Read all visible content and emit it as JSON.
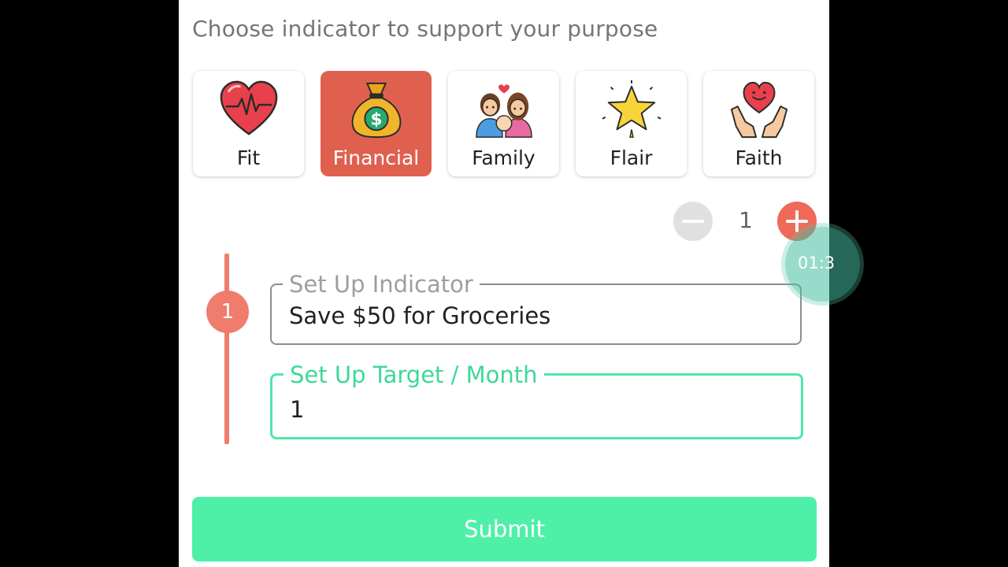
{
  "heading": "Choose indicator to support your purpose",
  "categories": [
    {
      "label": "Fit",
      "icon": "heart-pulse-icon",
      "selected": false
    },
    {
      "label": "Financial",
      "icon": "money-bag-icon",
      "selected": true
    },
    {
      "label": "Family",
      "icon": "family-icon",
      "selected": false
    },
    {
      "label": "Flair",
      "icon": "star-icon",
      "selected": false
    },
    {
      "label": "Faith",
      "icon": "heart-hands-icon",
      "selected": false
    }
  ],
  "stepper": {
    "count": "1",
    "minus_icon": "minus-icon",
    "plus_icon": "plus-icon"
  },
  "timer": {
    "text": "01:3"
  },
  "step": {
    "number": "1"
  },
  "indicator_field": {
    "label": "Set Up Indicator",
    "value": "Save $50 for Groceries"
  },
  "target_field": {
    "label": "Set Up Target / Month",
    "value": "1"
  },
  "submit_label": "Submit",
  "colors": {
    "accent": "#ef6a58",
    "selected_card": "#e0604f",
    "green": "#4ef0a8",
    "active_border": "#4ee8a8"
  }
}
